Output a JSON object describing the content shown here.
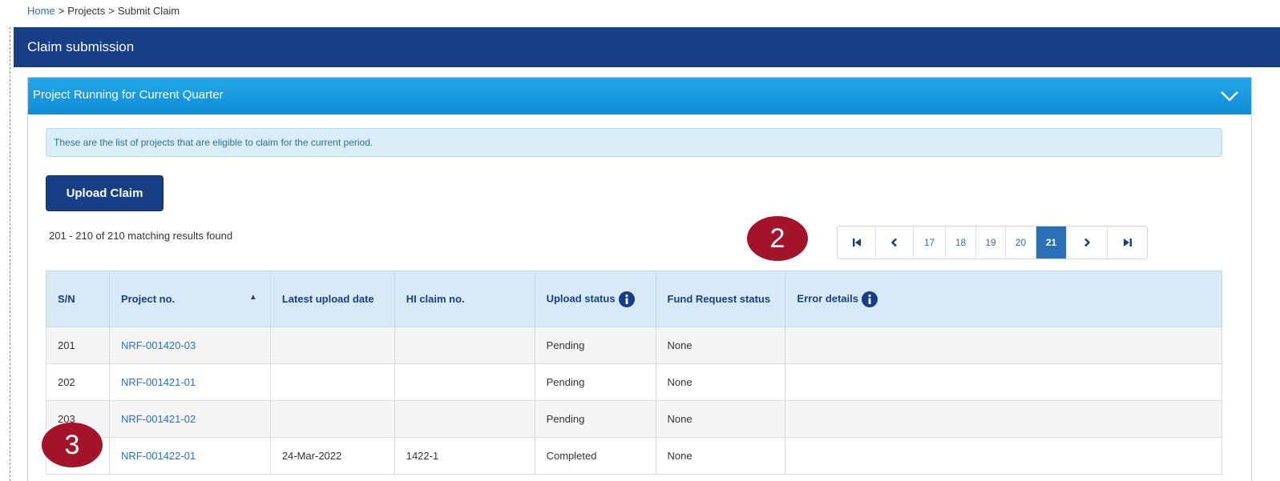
{
  "breadcrumb": {
    "home": "Home",
    "projects": "Projects",
    "current": "Submit Claim",
    "separator": ">"
  },
  "page_header": {
    "title": "Claim submission"
  },
  "panel": {
    "title": "Project Running for Current Quarter",
    "collapse_icon": "chevron-down-icon",
    "info_text": "These are the list of projects that are eligible to claim for the current period.",
    "upload_button": "Upload Claim",
    "results_text": "201 - 210 of 210 matching results found"
  },
  "pagination": {
    "first_icon": "first-page-icon",
    "prev_icon": "prev-page-icon",
    "next_icon": "next-page-icon",
    "last_icon": "last-page-icon",
    "pages": [
      "17",
      "18",
      "19",
      "20",
      "21"
    ],
    "active_page": "21"
  },
  "table": {
    "columns": [
      "S/N",
      "Project no.",
      "Latest upload date",
      "HI claim no.",
      "Upload status",
      "Fund Request status",
      "Error details"
    ],
    "sort_indicator": "▲",
    "rows": [
      {
        "sn": "201",
        "project": "NRF-001420-03",
        "date": "",
        "claim": "",
        "status": "Pending",
        "fund": "None",
        "error": ""
      },
      {
        "sn": "202",
        "project": "NRF-001421-01",
        "date": "",
        "claim": "",
        "status": "Pending",
        "fund": "None",
        "error": ""
      },
      {
        "sn": "203",
        "project": "NRF-001421-02",
        "date": "",
        "claim": "",
        "status": "Pending",
        "fund": "None",
        "error": ""
      },
      {
        "sn": "",
        "project": "NRF-001422-01",
        "date": "24-Mar-2022",
        "claim": "1422-1",
        "status": "Completed",
        "fund": "None",
        "error": ""
      }
    ]
  },
  "callouts": {
    "two": "2",
    "three": "3"
  },
  "colors": {
    "header_navy": "#173f85",
    "panel_blue": "#1a9be0",
    "link_blue": "#2a6fc4",
    "callout_red": "#a31329",
    "table_header_bg": "#d8e9f6"
  }
}
